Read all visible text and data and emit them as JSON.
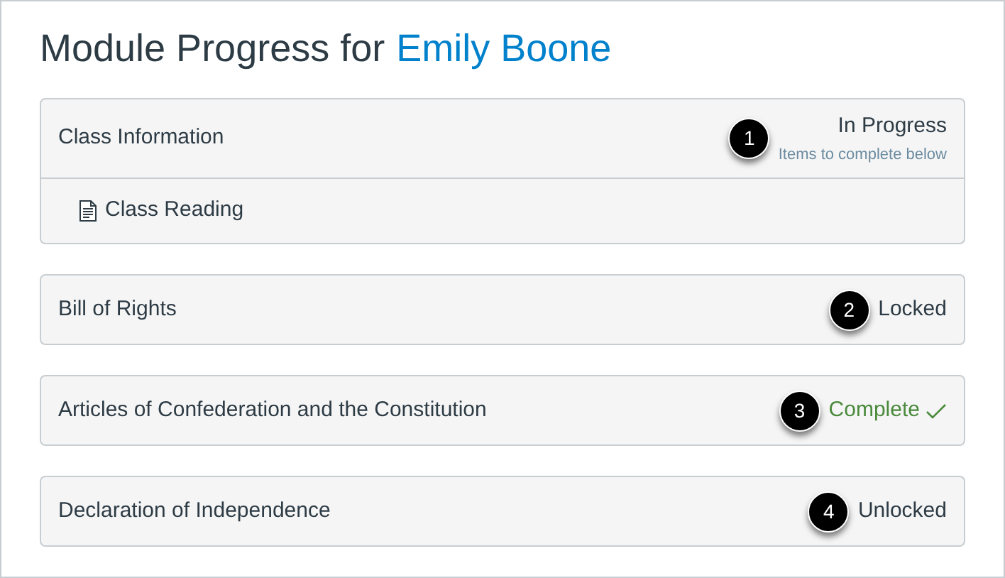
{
  "heading": {
    "prefix": "Module Progress for",
    "student": "Emily Boone"
  },
  "modules": [
    {
      "name": "Class Information",
      "callout": "1",
      "status": "In Progress",
      "kind": "in_progress",
      "subtitle": "Items to complete below",
      "items": [
        {
          "label": "Class Reading"
        }
      ]
    },
    {
      "name": "Bill of Rights",
      "callout": "2",
      "status": "Locked",
      "kind": "locked"
    },
    {
      "name": "Articles of Confederation and the Constitution",
      "callout": "3",
      "status": "Complete",
      "kind": "complete"
    },
    {
      "name": "Declaration of Independence",
      "callout": "4",
      "status": "Unlocked",
      "kind": "unlocked"
    }
  ]
}
